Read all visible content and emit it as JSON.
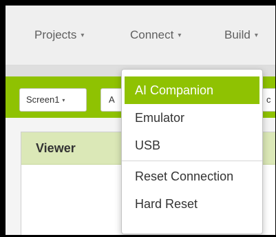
{
  "menubar": {
    "items": [
      {
        "label": "Projects"
      },
      {
        "label": "Connect"
      },
      {
        "label": "Build"
      }
    ],
    "caret": "▾"
  },
  "toolbar": {
    "screen_button": "Screen1",
    "next_button_partial": "A",
    "right_partial": "c"
  },
  "viewer": {
    "title": "Viewer"
  },
  "connect_menu": {
    "items": [
      {
        "label": "AI Companion",
        "active": true
      },
      {
        "label": "Emulator",
        "active": false
      },
      {
        "label": "USB",
        "active": false
      },
      {
        "label": "Reset Connection",
        "active": false
      },
      {
        "label": "Hard Reset",
        "active": false
      }
    ]
  },
  "colors": {
    "accent_green": "#8fc202",
    "viewer_header": "#dbe8b7",
    "menu_text": "#5f5f5f"
  }
}
